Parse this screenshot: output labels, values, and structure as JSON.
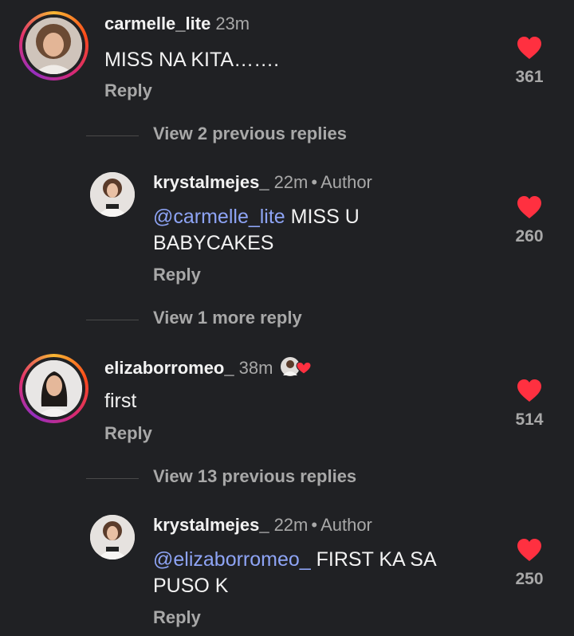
{
  "colors": {
    "background": "#202124",
    "heart": "#ff3040",
    "mention": "#8ea4f5",
    "muted": "#a8a8a8"
  },
  "comments": [
    {
      "username": "carmelle_lite",
      "time": "23m",
      "text": "MISS NA KITA…….",
      "reply": "Reply",
      "likes": "361"
    },
    {
      "view_replies": "View 2 previous replies"
    },
    {
      "username": "krystalmejes_",
      "time": "22m",
      "author_tag": "Author",
      "mention": "@carmelle_lite",
      "text": " MISS U BABYCAKES",
      "reply": "Reply",
      "likes": "260"
    },
    {
      "view_replies": "View 1 more reply"
    },
    {
      "username": "elizaborromeo_",
      "time": "38m",
      "text": "first",
      "reply": "Reply",
      "likes": "514"
    },
    {
      "view_replies": "View 13 previous replies"
    },
    {
      "username": "krystalmejes_",
      "time": "22m",
      "author_tag": "Author",
      "mention": "@elizaborromeo_",
      "text": " FIRST KA SA PUSO K",
      "reply": "Reply",
      "likes": "250"
    }
  ],
  "separator": "•",
  "icons": {
    "heart": "heart-icon",
    "liked_by_author": "liked-by-author-badge-icon"
  }
}
